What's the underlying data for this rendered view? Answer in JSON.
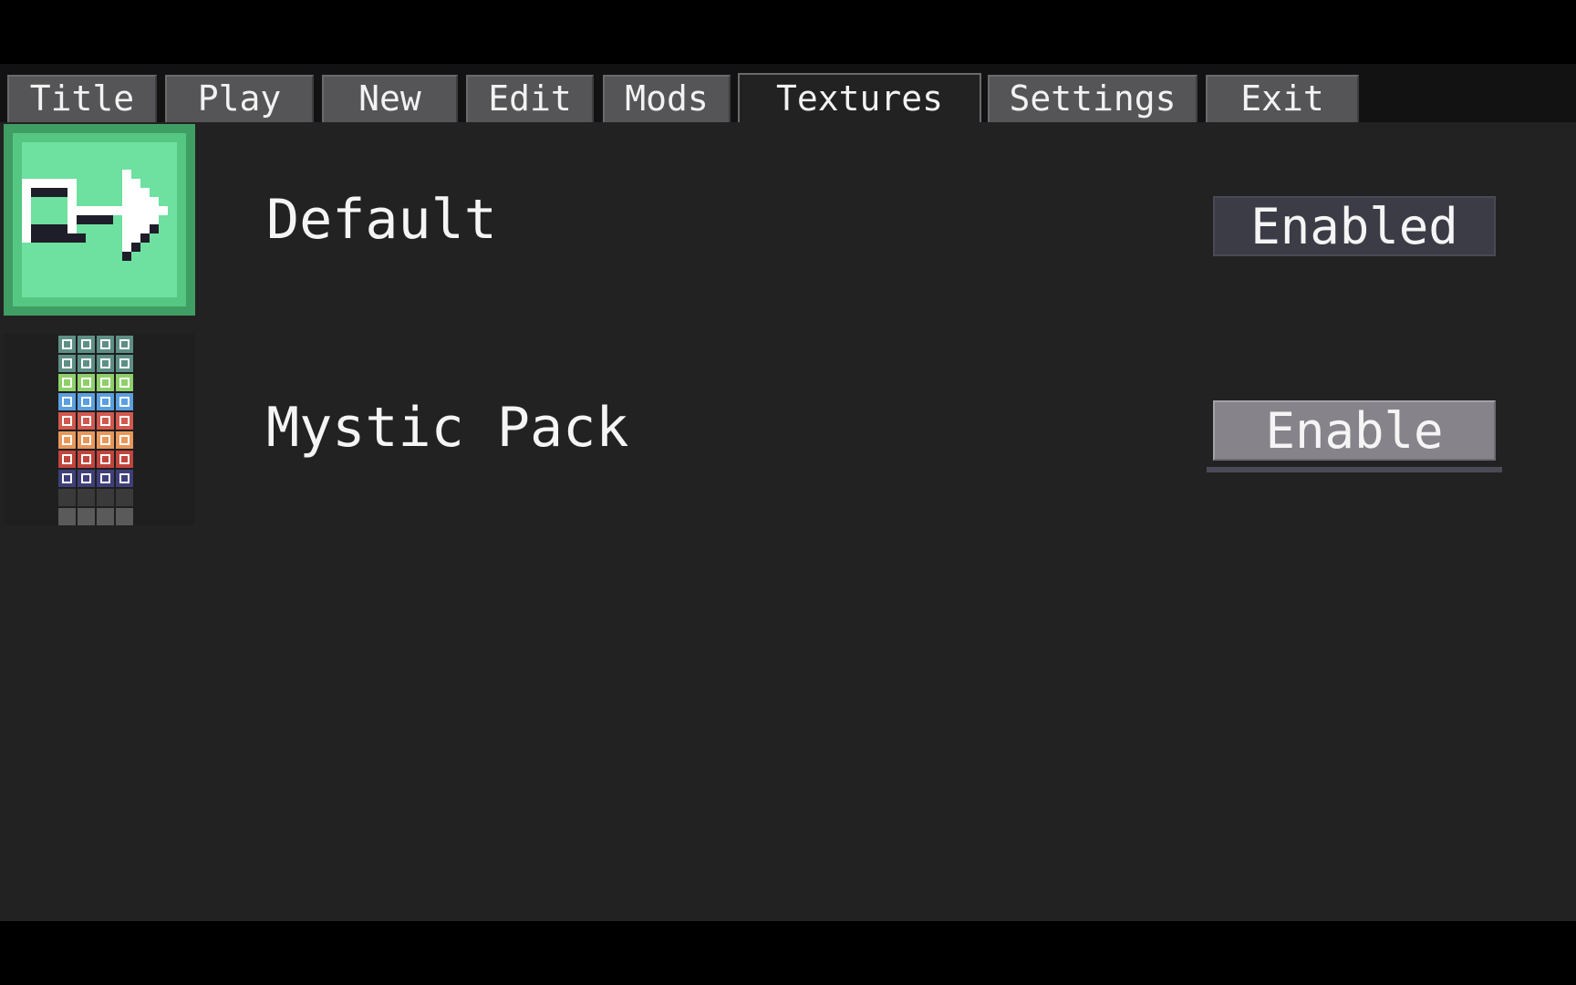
{
  "menu": {
    "tabs": [
      {
        "label": "Title"
      },
      {
        "label": "Play"
      },
      {
        "label": "New"
      },
      {
        "label": "Edit"
      },
      {
        "label": "Mods"
      },
      {
        "label": "Textures"
      },
      {
        "label": "Settings"
      },
      {
        "label": "Exit"
      }
    ],
    "active_tab": "Textures"
  },
  "texture_packs": [
    {
      "name": "Default",
      "button_label": "Enabled",
      "state": "enabled",
      "icon": "green-exit-arrow-icon"
    },
    {
      "name": "Mystic Pack",
      "button_label": "Enable",
      "state": "disabled",
      "icon": "tile-grid-icon"
    }
  ],
  "colors": {
    "background": "#222222",
    "tab": "#555557",
    "enabled_button": "#3c3c46",
    "enable_button": "#86838b",
    "icon_green": "#6ee0a0"
  }
}
